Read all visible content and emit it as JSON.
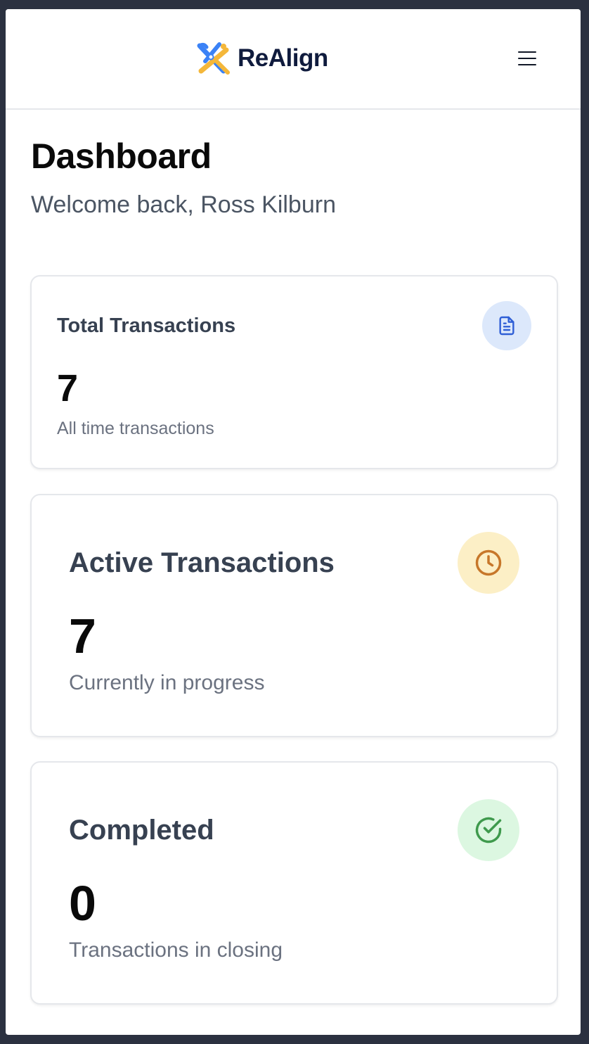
{
  "header": {
    "brand_name": "ReAlign",
    "logo_icon": "realign-logo-icon",
    "menu_icon": "hamburger-menu-icon"
  },
  "page": {
    "title": "Dashboard",
    "welcome": "Welcome back, Ross Kilburn"
  },
  "cards": [
    {
      "title": "Total Transactions",
      "value": "7",
      "subtitle": "All time transactions",
      "icon": "document-icon",
      "icon_color": "#2f5fd6",
      "icon_bg": "#dce8fb"
    },
    {
      "title": "Active Transactions",
      "value": "7",
      "subtitle": "Currently in progress",
      "icon": "clock-icon",
      "icon_color": "#c7772a",
      "icon_bg": "#fcefc6"
    },
    {
      "title": "Completed",
      "value": "0",
      "subtitle": "Transactions in closing",
      "icon": "check-circle-icon",
      "icon_color": "#3f9a4d",
      "icon_bg": "#dcf7e1"
    }
  ],
  "colors": {
    "brand_navy": "#0f1b3d",
    "brand_blue": "#3b82f6",
    "brand_yellow": "#f4b73a",
    "background_frame": "#2b3140"
  }
}
